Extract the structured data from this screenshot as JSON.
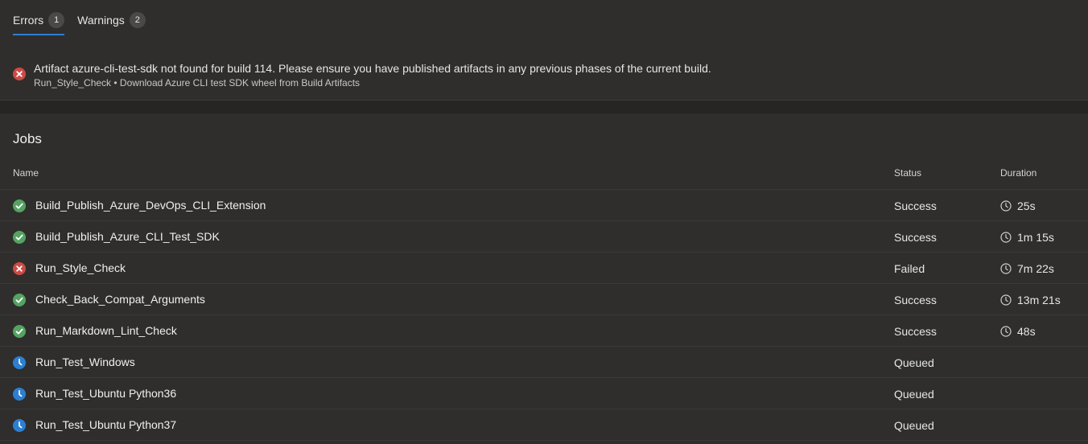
{
  "tabs": [
    {
      "label": "Errors",
      "count": "1",
      "active": true
    },
    {
      "label": "Warnings",
      "count": "2",
      "active": false
    }
  ],
  "error": {
    "icon": "error-circle-icon",
    "message": "Artifact azure-cli-test-sdk not found for build 114. Please ensure you have published artifacts in any previous phases of the current build.",
    "source": "Run_Style_Check • Download Azure CLI test SDK wheel from Build Artifacts"
  },
  "jobs": {
    "title": "Jobs",
    "columns": {
      "name": "Name",
      "status": "Status",
      "duration": "Duration"
    },
    "rows": [
      {
        "name": "Build_Publish_Azure_DevOps_CLI_Extension",
        "status": "Success",
        "duration": "25s",
        "icon": "success-check-icon"
      },
      {
        "name": "Build_Publish_Azure_CLI_Test_SDK",
        "status": "Success",
        "duration": "1m 15s",
        "icon": "success-check-icon"
      },
      {
        "name": "Run_Style_Check",
        "status": "Failed",
        "duration": "7m 22s",
        "icon": "error-circle-icon"
      },
      {
        "name": "Check_Back_Compat_Arguments",
        "status": "Success",
        "duration": "13m 21s",
        "icon": "success-check-icon"
      },
      {
        "name": "Run_Markdown_Lint_Check",
        "status": "Success",
        "duration": "48s",
        "icon": "success-check-icon"
      },
      {
        "name": "Run_Test_Windows",
        "status": "Queued",
        "duration": "",
        "icon": "queued-clock-icon"
      },
      {
        "name": "Run_Test_Ubuntu Python36",
        "status": "Queued",
        "duration": "",
        "icon": "queued-clock-icon"
      },
      {
        "name": "Run_Test_Ubuntu Python37",
        "status": "Queued",
        "duration": "",
        "icon": "queued-clock-icon"
      }
    ]
  },
  "colors": {
    "success": "#55a362",
    "failed": "#cd4a45",
    "queued": "#2d7fd1",
    "accent": "#2d7fd1",
    "background": "#2f2e2d"
  }
}
